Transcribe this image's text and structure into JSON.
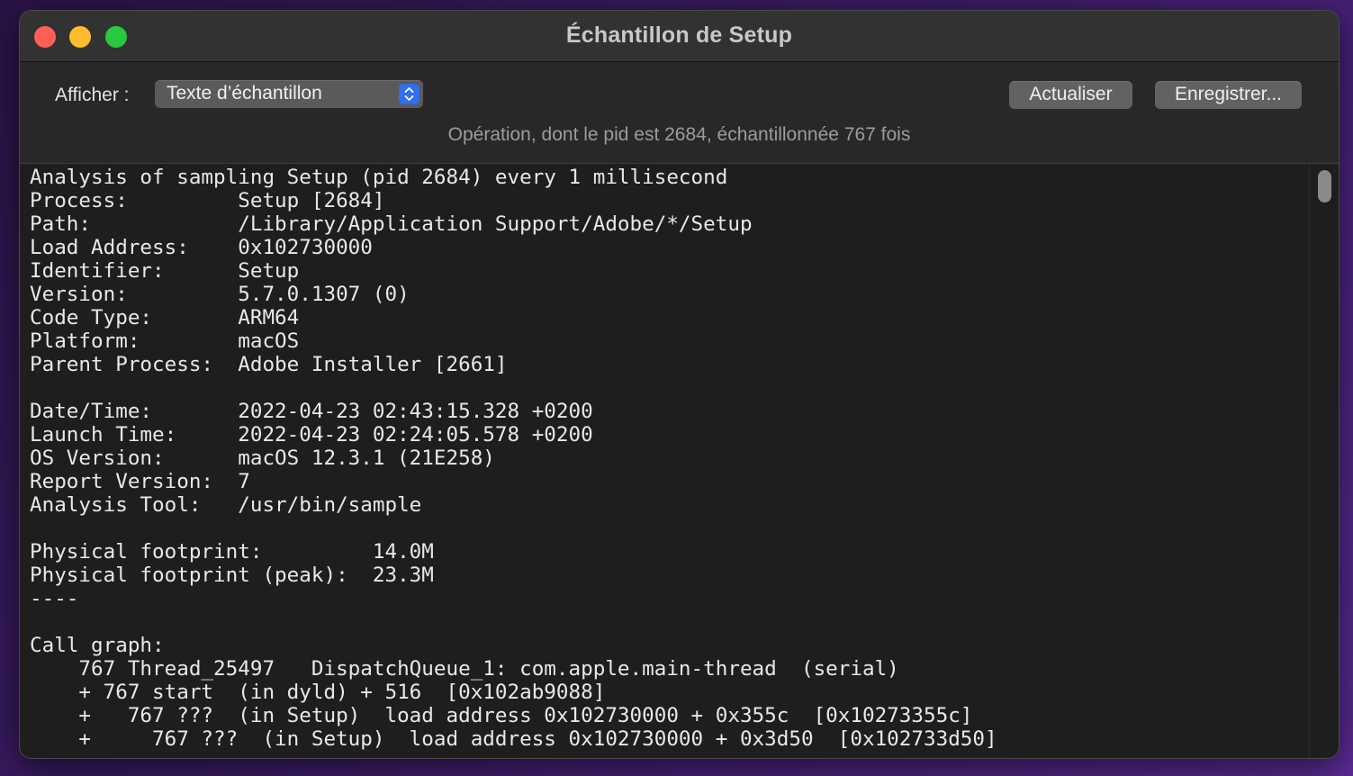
{
  "window": {
    "title": "Échantillon de Setup"
  },
  "toolbar": {
    "show_label": "Afficher :",
    "view_select": {
      "selected": "Texte d’échantillon"
    },
    "refresh_label": "Actualiser",
    "save_label": "Enregistrer..."
  },
  "status": "Opération, dont le pid est 2684, échantillonnée 767 fois",
  "report_lines": [
    "Analysis of sampling Setup (pid 2684) every 1 millisecond",
    "Process:         Setup [2684]",
    "Path:            /Library/Application Support/Adobe/*/Setup",
    "Load Address:    0x102730000",
    "Identifier:      Setup",
    "Version:         5.7.0.1307 (0)",
    "Code Type:       ARM64",
    "Platform:        macOS",
    "Parent Process:  Adobe Installer [2661]",
    "",
    "Date/Time:       2022-04-23 02:43:15.328 +0200",
    "Launch Time:     2022-04-23 02:24:05.578 +0200",
    "OS Version:      macOS 12.3.1 (21E258)",
    "Report Version:  7",
    "Analysis Tool:   /usr/bin/sample",
    "",
    "Physical footprint:         14.0M",
    "Physical footprint (peak):  23.3M",
    "----",
    "",
    "Call graph:",
    "    767 Thread_25497   DispatchQueue_1: com.apple.main-thread  (serial)",
    "    + 767 start  (in dyld) + 516  [0x102ab9088]",
    "    +   767 ???  (in Setup)  load address 0x102730000 + 0x355c  [0x10273355c]",
    "    +     767 ???  (in Setup)  load address 0x102730000 + 0x3d50  [0x102733d50]"
  ],
  "colors": {
    "close": "#ff5f57",
    "minimize": "#febc2e",
    "maximize": "#28c840",
    "select_accent": "#2f6ff0"
  },
  "icons": {
    "select_arrows": "chevron-up-down-icon"
  }
}
